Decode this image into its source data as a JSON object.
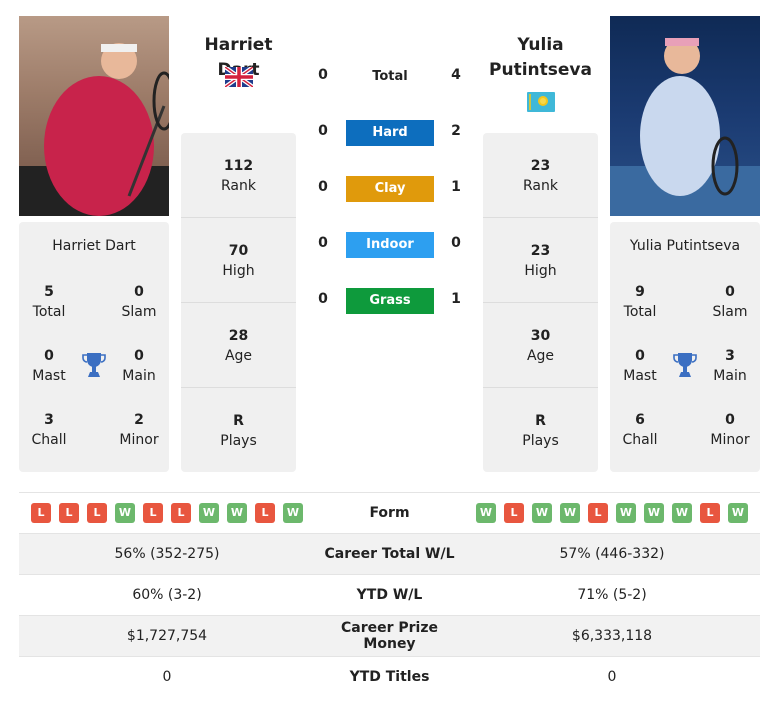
{
  "players": {
    "left": {
      "name": "Harriet Dart",
      "flag": "gb-flag",
      "titles": {
        "total": {
          "value": "5",
          "label": "Total"
        },
        "slam": {
          "value": "0",
          "label": "Slam"
        },
        "mast": {
          "value": "0",
          "label": "Mast"
        },
        "main": {
          "value": "0",
          "label": "Main"
        },
        "chall": {
          "value": "3",
          "label": "Chall"
        },
        "minor": {
          "value": "2",
          "label": "Minor"
        }
      },
      "stats": [
        {
          "value": "112",
          "label": "Rank"
        },
        {
          "value": "70",
          "label": "High"
        },
        {
          "value": "28",
          "label": "Age"
        },
        {
          "value": "R",
          "label": "Plays"
        }
      ],
      "form": [
        "L",
        "L",
        "L",
        "W",
        "L",
        "L",
        "W",
        "W",
        "L",
        "W"
      ]
    },
    "right": {
      "name": "Yulia Putintseva",
      "name_line1": "Yulia",
      "name_line2": "Putintseva",
      "flag": "kz-flag",
      "titles": {
        "total": {
          "value": "9",
          "label": "Total"
        },
        "slam": {
          "value": "0",
          "label": "Slam"
        },
        "mast": {
          "value": "0",
          "label": "Mast"
        },
        "main": {
          "value": "3",
          "label": "Main"
        },
        "chall": {
          "value": "6",
          "label": "Chall"
        },
        "minor": {
          "value": "0",
          "label": "Minor"
        }
      },
      "stats": [
        {
          "value": "23",
          "label": "Rank"
        },
        {
          "value": "23",
          "label": "High"
        },
        {
          "value": "30",
          "label": "Age"
        },
        {
          "value": "R",
          "label": "Plays"
        }
      ],
      "form": [
        "W",
        "L",
        "W",
        "W",
        "L",
        "W",
        "W",
        "W",
        "L",
        "W"
      ]
    }
  },
  "h2h": [
    {
      "label": "Total",
      "left": "0",
      "right": "4",
      "color": null
    },
    {
      "label": "Hard",
      "left": "0",
      "right": "2",
      "color": "#0d6ebe"
    },
    {
      "label": "Clay",
      "left": "0",
      "right": "1",
      "color": "#e09a0c"
    },
    {
      "label": "Indoor",
      "left": "0",
      "right": "0",
      "color": "#2d9ff0"
    },
    {
      "label": "Grass",
      "left": "0",
      "right": "1",
      "color": "#0e9a3c"
    }
  ],
  "table": {
    "form_label": "Form",
    "rows": [
      {
        "left": "56% (352-275)",
        "label": "Career Total W/L",
        "right": "57% (446-332)"
      },
      {
        "left": "60% (3-2)",
        "label": "YTD W/L",
        "right": "71% (5-2)"
      },
      {
        "left": "$1,727,754",
        "label": "Career Prize Money",
        "right": "$6,333,118"
      },
      {
        "left": "0",
        "label": "YTD Titles",
        "right": "0"
      }
    ]
  }
}
